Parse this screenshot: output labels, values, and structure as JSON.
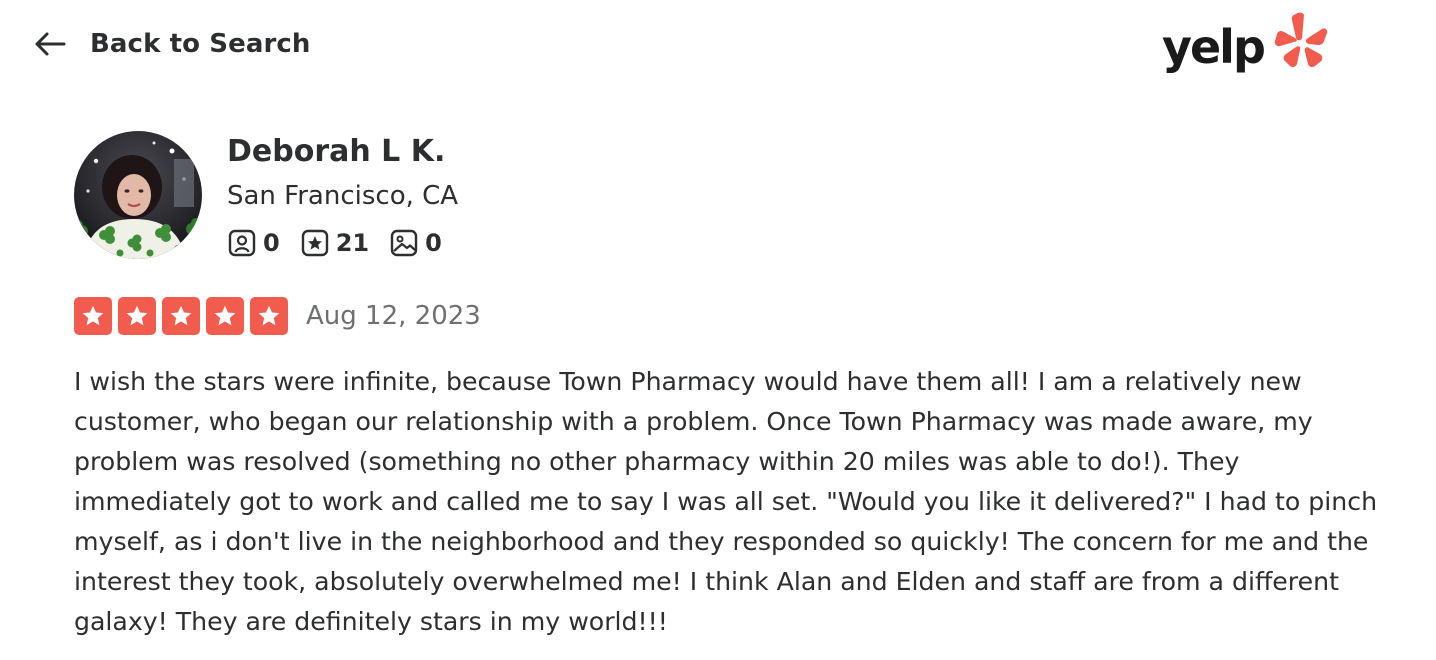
{
  "header": {
    "back_label": "Back to Search",
    "logo_text": "yelp"
  },
  "user": {
    "name": "Deborah L K.",
    "location": "San Francisco, CA",
    "stats": {
      "friends": "0",
      "reviews": "21",
      "photos": "0"
    }
  },
  "review": {
    "rating": 5,
    "date": "Aug 12, 2023",
    "text": "I wish the stars were infinite, because Town Pharmacy would have them all! I am a relatively new customer, who began our relationship with a problem. Once Town Pharmacy was made aware, my problem was resolved (something no other pharmacy within 20 miles was able to do!). They immediately got to work and called me to say I was all set. \"Would you like it delivered?\" I had to pinch myself, as i don't live in the neighborhood and they responded so quickly! The concern for me and the interest they took, absolutely overwhelmed me! I think Alan and Elden and staff are from a different galaxy! They are definitely stars in my world!!!"
  },
  "colors": {
    "brand_red": "#f15c4f",
    "text": "#2d2e2f",
    "muted": "#6e7072"
  }
}
